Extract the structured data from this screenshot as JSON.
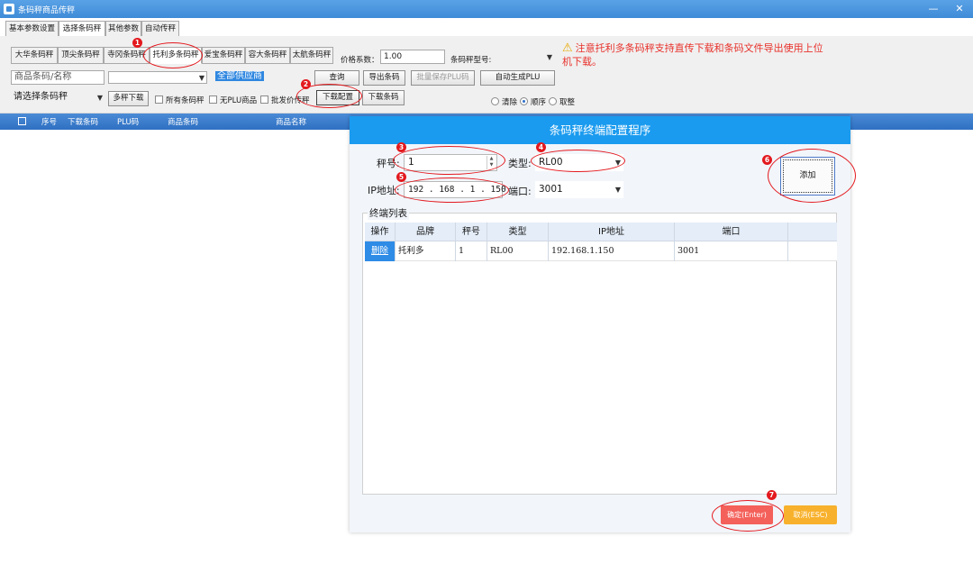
{
  "window": {
    "title": "条码秤商品传秤",
    "minimize": "—",
    "close": "✕"
  },
  "main_tabs": [
    {
      "label": "基本参数设置"
    },
    {
      "label": "选择条码秤"
    },
    {
      "label": "其他参数"
    },
    {
      "label": "自动传秤"
    }
  ],
  "scale_tabs": [
    {
      "label": "大华条码秤"
    },
    {
      "label": "顶尖条码秤"
    },
    {
      "label": "寺冈条码秤"
    },
    {
      "label": "托利多条码秤"
    },
    {
      "label": "爱宝条码秤"
    },
    {
      "label": "容大条码秤"
    },
    {
      "label": "太航条码秤"
    }
  ],
  "toolbar": {
    "price_digits_label": "价格系数：",
    "price_digits_value": "1.00",
    "scale_model_label": "条码秤型号:",
    "warning_text": "注意托利多条码秤支持直传下载和条码文件导出使用上位机下载。",
    "product_search_placeholder": "商品条码/名称",
    "supplier_value": "全部供应商",
    "query_button": "查询",
    "export_barcode_button": "导出条码",
    "batch_save_plu_button": "批量保存PLU码",
    "auto_generate_plu_button": "自动生成PLU",
    "select_scale_placeholder": "请选择条码秤",
    "multi_download_button": "多秤下载",
    "all_scales_label": "所有条码秤",
    "no_plu_label": "无PLU商品",
    "wholesale_price_label": "批发价传秤",
    "download_config_button": "下载配置",
    "download_barcode_button": "下载条码",
    "clear_label": "清除",
    "order_label": "顺序",
    "integer_label": "取整"
  },
  "grid_columns": [
    "序号",
    "下载条码",
    "PLU码",
    "商品条码",
    "商品名称"
  ],
  "dialog": {
    "title": "条码秤终端配置程序",
    "scale_no_label": "秤号:",
    "scale_no_value": "1",
    "type_label": "类型:",
    "type_value": "RL00",
    "ip_label": "IP地址:",
    "ip_value": "192 . 168 .  1  . 150",
    "port_label": "端口:",
    "port_value": "3001",
    "add_button": "添加",
    "group_title": "终端列表",
    "list_columns": [
      "操作",
      "品牌",
      "秤号",
      "类型",
      "IP地址",
      "端口"
    ],
    "rows": [
      {
        "action": "删除",
        "brand": "托利多",
        "scale_no": "1",
        "type": "RL00",
        "ip": "192.168.1.150",
        "port": "3001"
      }
    ],
    "ok_button": "确定(Enter)",
    "cancel_button": "取消(ESC)"
  },
  "annotations": [
    "1",
    "2",
    "3",
    "4",
    "5",
    "6",
    "7"
  ],
  "colors": {
    "title_bar": "#3e8bd7",
    "dialog_header": "#1a9bef",
    "warning": "#e8312b",
    "annotation": "#e3191e",
    "ok": "#f4605a",
    "cancel": "#f8b12c"
  }
}
